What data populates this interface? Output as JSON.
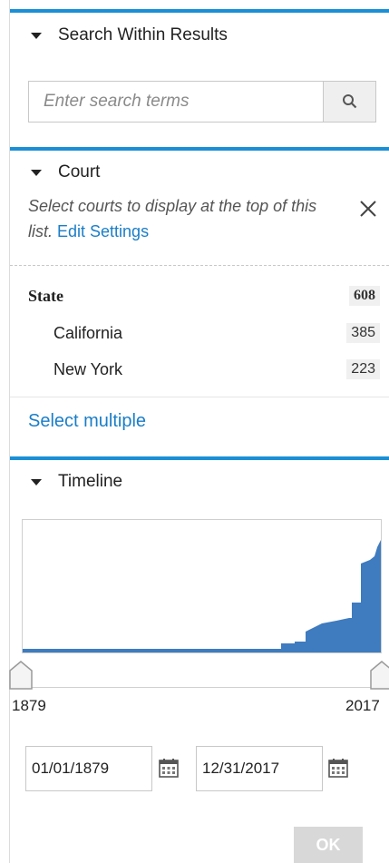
{
  "search_within": {
    "title": "Search Within Results",
    "placeholder": "Enter search terms",
    "search_icon": "magnifier-icon"
  },
  "court": {
    "title": "Court",
    "hint_text": "Select courts to display at the top of this list.",
    "edit_settings": "Edit Settings",
    "close_icon": "close-icon",
    "rows": [
      {
        "label": "State",
        "count": "608"
      },
      {
        "label": "California",
        "count": "385"
      },
      {
        "label": "New York",
        "count": "223"
      }
    ],
    "select_multiple": "Select multiple"
  },
  "timeline": {
    "title": "Timeline",
    "start_year": "1879",
    "end_year": "2017",
    "start_date": "01/01/1879",
    "end_date": "12/31/2017",
    "ok_label": "OK",
    "calendar_icon": "calendar-icon"
  },
  "colors": {
    "accent": "#1a8fd6",
    "link": "#1a7ec8",
    "chart_fill": "#3f7bbf"
  }
}
